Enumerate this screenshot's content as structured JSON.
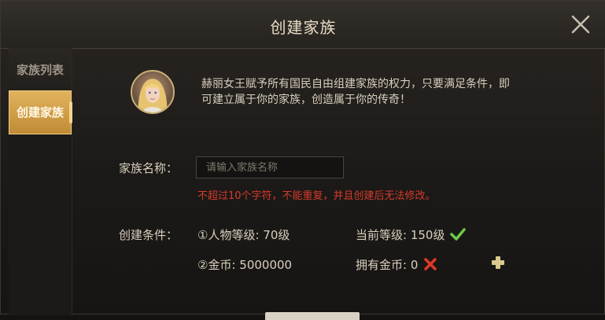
{
  "dialog": {
    "title": "创建家族",
    "close_icon": "close-icon"
  },
  "sidebar": {
    "tabs": [
      {
        "label": "家族列表",
        "active": false
      },
      {
        "label": "创建家族",
        "active": true
      }
    ]
  },
  "intro": {
    "description": "赫丽女王赋予所有国民自由组建家族的权力，只要满足条件，即可建立属于你的家族，创造属于你的传奇！"
  },
  "form": {
    "name_label": "家族名称：",
    "name_placeholder": "请输入家族名称",
    "name_value": "",
    "name_hint": "不超过10个字符，不能重复，并且创建后无法修改。"
  },
  "conditions": {
    "label": "创建条件：",
    "items": [
      {
        "requirement": "①人物等级: 70级",
        "current": "当前等级: 150级",
        "met": true,
        "status_icon": "check-icon"
      },
      {
        "requirement": "②金币: 5000000",
        "current": "拥有金币: 0",
        "met": false,
        "status_icon": "cross-icon"
      }
    ]
  },
  "colors": {
    "accent_gold": "#d9a54e",
    "hint_red": "#d73a2a",
    "check_green": "#6ec84a",
    "cross_red": "#e0392b"
  }
}
